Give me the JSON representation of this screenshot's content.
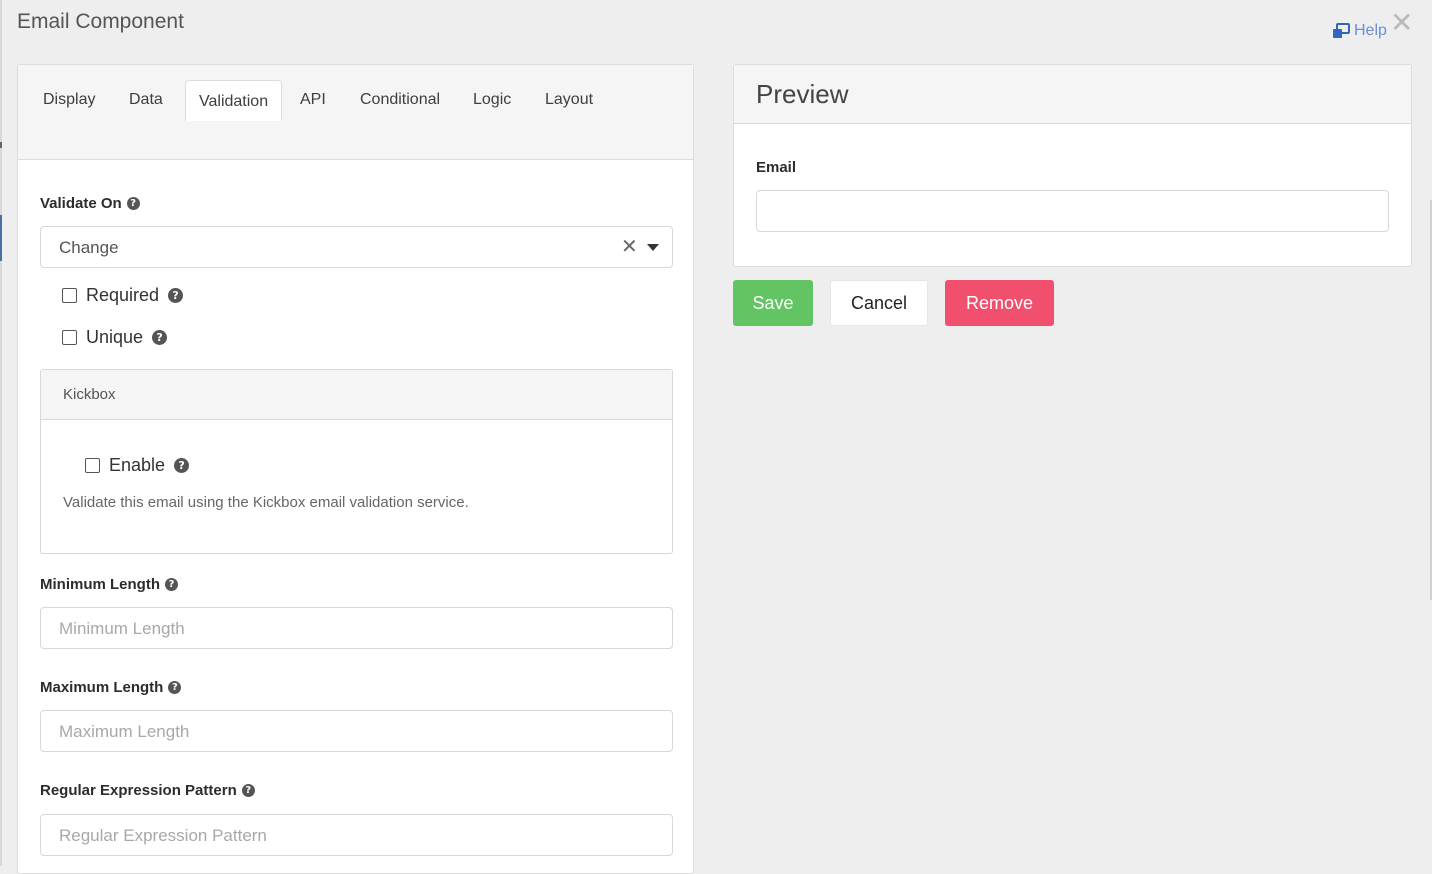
{
  "modal": {
    "title": "Email Component",
    "help_label": "Help",
    "close_glyph": "✕",
    "help_icon": "external-window-icon"
  },
  "tabs": [
    {
      "label": "Display",
      "active": false
    },
    {
      "label": "Data",
      "active": false
    },
    {
      "label": "Validation",
      "active": true
    },
    {
      "label": "API",
      "active": false
    },
    {
      "label": "Conditional",
      "active": false
    },
    {
      "label": "Logic",
      "active": false
    },
    {
      "label": "Layout",
      "active": false
    }
  ],
  "validation": {
    "validate_on": {
      "label": "Validate On",
      "value": "Change",
      "clear_glyph": "✕"
    },
    "required": {
      "label": "Required",
      "checked": false
    },
    "unique": {
      "label": "Unique",
      "checked": false
    },
    "kickbox": {
      "title": "Kickbox",
      "enable_label": "Enable",
      "enable_checked": false,
      "description": "Validate this email using the Kickbox email validation service."
    },
    "min_length": {
      "label": "Minimum Length",
      "placeholder": "Minimum Length"
    },
    "max_length": {
      "label": "Maximum Length",
      "placeholder": "Maximum Length"
    },
    "regex": {
      "label": "Regular Expression Pattern",
      "placeholder": "Regular Expression Pattern"
    }
  },
  "preview": {
    "title": "Preview",
    "field_label": "Email",
    "field_value": ""
  },
  "actions": {
    "save": "Save",
    "cancel": "Cancel",
    "remove": "Remove"
  },
  "colors": {
    "save": "#62c462",
    "remove": "#f0506e",
    "help_link": "#6b8fd6"
  }
}
